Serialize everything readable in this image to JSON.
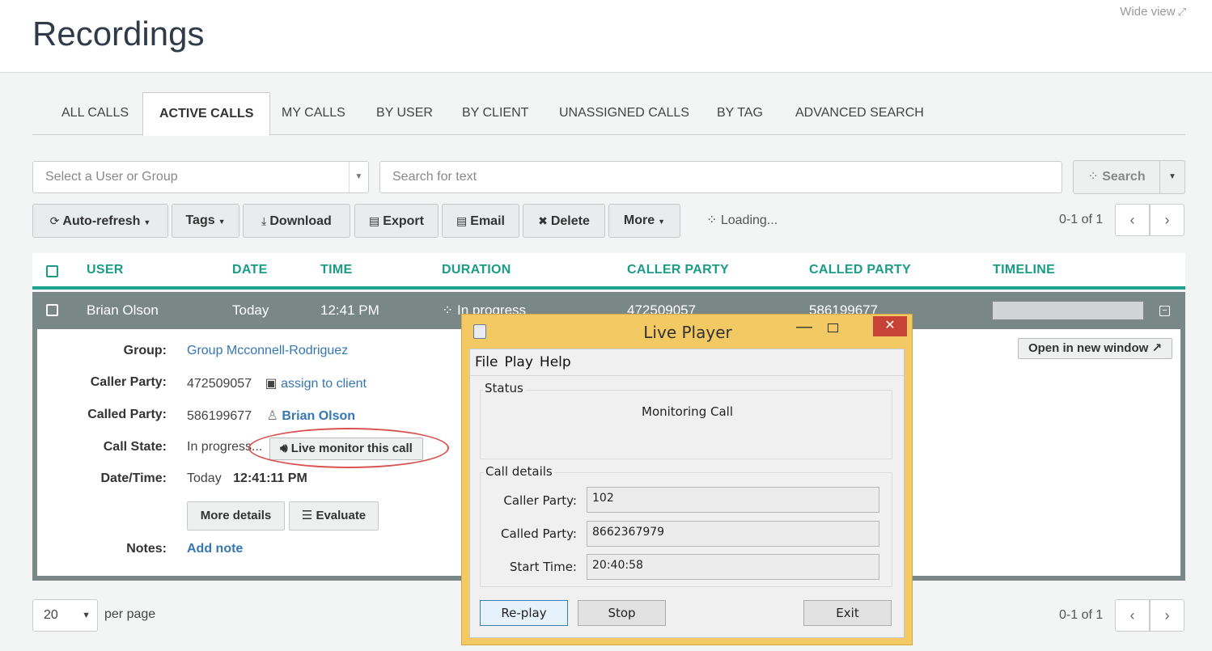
{
  "header": {
    "title": "Recordings",
    "wide_view": "Wide view"
  },
  "tabs": [
    {
      "label": "ALL CALLS"
    },
    {
      "label": "ACTIVE CALLS"
    },
    {
      "label": "MY CALLS"
    },
    {
      "label": "BY USER"
    },
    {
      "label": "BY CLIENT"
    },
    {
      "label": "UNASSIGNED CALLS"
    },
    {
      "label": "BY TAG"
    },
    {
      "label": "ADVANCED SEARCH"
    }
  ],
  "filters": {
    "user_group_placeholder": "Select a User or Group",
    "search_placeholder": "Search for text",
    "search_button": "Search"
  },
  "toolbar": {
    "auto_refresh": "Auto-refresh",
    "tags": "Tags",
    "download": "Download",
    "export": "Export",
    "email": "Email",
    "delete": "Delete",
    "more": "More",
    "loading": "Loading...",
    "pager": "0-1 of 1"
  },
  "table": {
    "columns": [
      "USER",
      "DATE",
      "TIME",
      "DURATION",
      "CALLER PARTY",
      "CALLED PARTY",
      "TIMELINE"
    ],
    "row": {
      "user": "Brian Olson",
      "date": "Today",
      "time": "12:41 PM",
      "duration": "In progress",
      "caller": "472509057",
      "called": "586199677"
    }
  },
  "detail": {
    "group_label": "Group:",
    "group_value": "Group Mcconnell-Rodriguez",
    "caller_label": "Caller Party:",
    "caller_value": "472509057",
    "assign_client": "assign to client",
    "called_label": "Called Party:",
    "called_value": "586199677",
    "called_user": "Brian Olson",
    "state_label": "Call State:",
    "state_value": "In progress...",
    "live_monitor": "Live monitor this call",
    "datetime_label": "Date/Time:",
    "date_value": "Today",
    "time_value": "12:41:11 PM",
    "more_details": "More details",
    "evaluate": "Evaluate",
    "notes_label": "Notes:",
    "add_note": "Add note",
    "open_new_window": "Open in new window"
  },
  "footer": {
    "per_page_value": "20",
    "per_page_label": "per page",
    "pager": "0-1 of 1"
  },
  "live_player": {
    "title": "Live Player",
    "menu": [
      "File",
      "Play",
      "Help"
    ],
    "status_label": "Status",
    "status_value": "Monitoring Call",
    "details_label": "Call details",
    "caller_label": "Caller Party:",
    "caller_value": "102",
    "called_label": "Called Party:",
    "called_value": "8662367979",
    "start_label": "Start Time:",
    "start_value": "20:40:58",
    "replay": "Re-play",
    "stop": "Stop",
    "exit": "Exit"
  },
  "colors": {
    "accent": "#1a9c86",
    "row_selected": "#7a8787",
    "link": "#3576b4",
    "annotation": "#d9534f",
    "window_frame": "#f2c962",
    "close_button": "#c74237"
  }
}
